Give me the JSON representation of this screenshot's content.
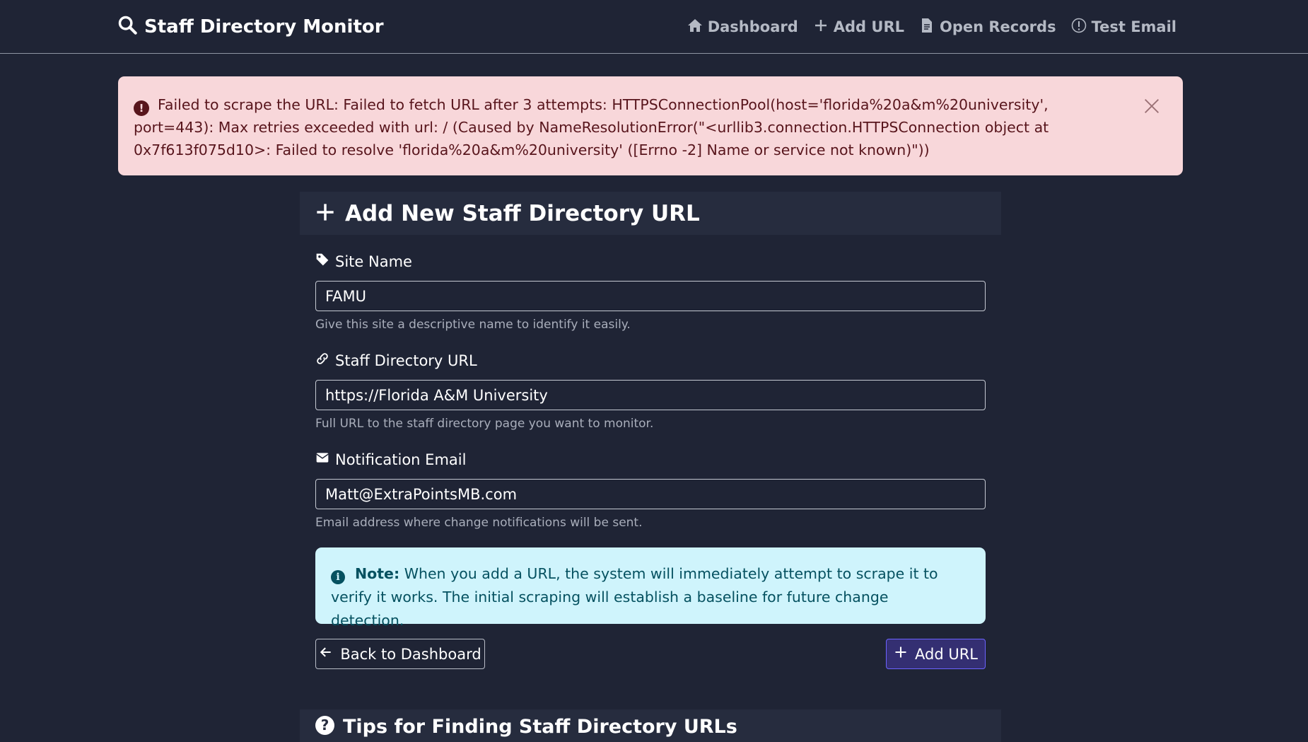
{
  "navbar": {
    "brand": "Staff Directory Monitor",
    "brand_icon": "search-icon",
    "links": [
      {
        "label": "Dashboard",
        "icon": "home-icon"
      },
      {
        "label": "Add URL",
        "icon": "plus-icon"
      },
      {
        "label": "Open Records",
        "icon": "file-icon"
      },
      {
        "label": "Test Email",
        "icon": "alert-circle-icon"
      }
    ]
  },
  "alert": {
    "message": "Failed to scrape the URL: Failed to fetch URL after 3 attempts: HTTPSConnectionPool(host='florida%20a&m%20university', port=443): Max retries exceeded with url: / (Caused by NameResolutionError(\"<urllib3.connection.HTTPSConnection object at 0x7f613f075d10>: Failed to resolve 'florida%20a&m%20university' ([Errno -2] Name or service not known)\"))",
    "icon": "exclamation-circle-icon"
  },
  "form": {
    "title": "Add New Staff Directory URL",
    "site_name": {
      "label": "Site Name",
      "value": "FAMU",
      "help": "Give this site a descriptive name to identify it easily."
    },
    "url": {
      "label": "Staff Directory URL",
      "value": "https://Florida A&M University",
      "help": "Full URL to the staff directory page you want to monitor."
    },
    "email": {
      "label": "Notification Email",
      "value": "Matt@ExtraPointsMB.com",
      "help": "Email address where change notifications will be sent."
    },
    "note": {
      "bold": "Note:",
      "text": "When you add a URL, the system will immediately attempt to scrape it to verify it works. The initial scraping will establish a baseline for future change detection."
    },
    "back_label": "Back to Dashboard",
    "submit_label": "Add URL"
  },
  "tips": {
    "title": "Tips for Finding Staff Directory URLs"
  },
  "colors": {
    "background": "#1f2435",
    "alert_bg": "#f8d7da",
    "note_bg": "#cff4fc",
    "primary": "#342f72"
  }
}
